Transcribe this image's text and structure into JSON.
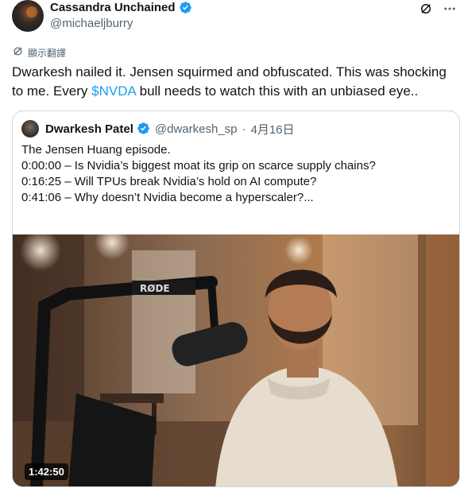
{
  "author": {
    "display_name": "Cassandra Unchained",
    "handle": "@michaeljburry",
    "avatar_icon": "profile-avatar",
    "verified": true
  },
  "translate": {
    "label": "顯示翻譯"
  },
  "tweet": {
    "text_before": "Dwarkesh nailed it. Jensen squirmed and obfuscated. This was shocking to me.  Every ",
    "cashtag": "$NVDA",
    "text_after": " bull needs to watch this with an unbiased eye.."
  },
  "quote": {
    "display_name": "Dwarkesh Patel",
    "handle": "@dwarkesh_sp",
    "separator": "·",
    "date": "4月16日",
    "lines": [
      "The Jensen Huang episode.",
      "",
      "0:00:00 – Is Nvidia’s biggest moat its grip on scarce supply chains?",
      "0:16:25 – Will TPUs break Nvidia’s hold on AI compute?",
      "0:41:06 – Why doesn’t Nvidia become a hyperscaler?..."
    ],
    "video": {
      "duration": "1:42:50",
      "mic_brand": "RØDE"
    }
  },
  "colors": {
    "accent": "#1d9bf0",
    "text": "#0f1419",
    "muted": "#536471",
    "border": "#cfd9de"
  },
  "icons": [
    "verified-badge-icon",
    "grok-icon",
    "more-icon",
    "translate-icon"
  ]
}
